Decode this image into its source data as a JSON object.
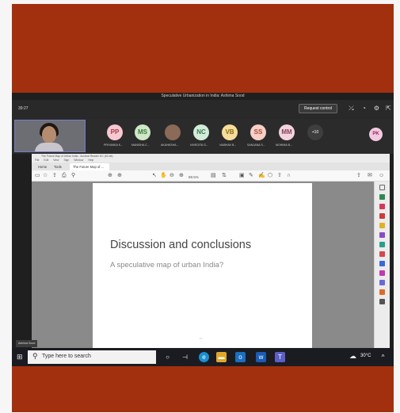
{
  "meeting": {
    "title": "Speculative Urbanization in India: Ashima Sood",
    "time": "39:27",
    "request_control": "Request control"
  },
  "participants": [
    {
      "initials": "PP",
      "name": "PRIYANKA K...",
      "bg": "#f6c8cf",
      "fg": "#a63a4a"
    },
    {
      "initials": "MS",
      "name": "MANISHA C...",
      "bg": "#cfe7c9",
      "fg": "#3e7a3c"
    },
    {
      "initials": "",
      "name": "AKANKSHA...",
      "bg": "#8b6a57",
      "fg": "#fff"
    },
    {
      "initials": "NC",
      "name": "NIVEDITA G...",
      "bg": "#d3ecda",
      "fg": "#3d7a52"
    },
    {
      "initials": "VB",
      "name": "VAIBHAV B...",
      "bg": "#f6de9a",
      "fg": "#8a6a14"
    },
    {
      "initials": "SS",
      "name": "SANJANA S...",
      "bg": "#f7cfc6",
      "fg": "#a84c38"
    },
    {
      "initials": "MM",
      "name": "MOHIMA B...",
      "bg": "#f1d4dd",
      "fg": "#8a4058"
    }
  ],
  "more_count": "+10",
  "side_avatar": "PK",
  "self_label": "Ashima Sood",
  "pdf": {
    "window_title": "The Future Map of Urban India - Acrobat Reader DC (64-bit)",
    "menu": [
      "File",
      "Edit",
      "View",
      "Sign",
      "Window",
      "Help"
    ],
    "tabs": {
      "home": "Home",
      "tools": "Tools",
      "doc": "The Future Map of ..."
    },
    "zoom": "88.5%",
    "slide_title": "Discussion and conclusions",
    "slide_subtitle": "A speculative map of urban India?",
    "page_number": "17"
  },
  "taskbar": {
    "search_placeholder": "Type here to search",
    "temperature": "30°C"
  },
  "colors": {
    "frame": "#a2300f",
    "teams_dark": "#292929",
    "viewer_gray": "#8a8a8a"
  }
}
